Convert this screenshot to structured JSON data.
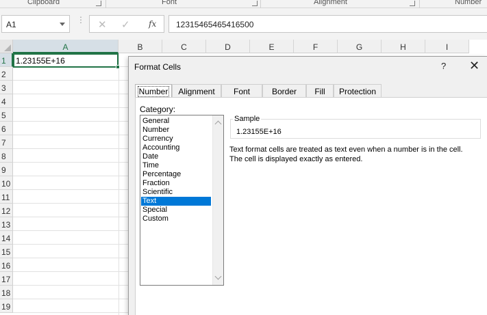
{
  "ribbon": {
    "groups": [
      "Clipboard",
      "Font",
      "Alignment",
      "Number"
    ]
  },
  "formula_bar": {
    "name_box": "A1",
    "cancel_icon": "x-icon",
    "enter_icon": "check-icon",
    "fx_label": "fx",
    "value": "12315465465416500"
  },
  "grid": {
    "columns": [
      "A",
      "B",
      "C",
      "D",
      "E",
      "F",
      "G",
      "H",
      "I"
    ],
    "rows": [
      "1",
      "2",
      "3",
      "4",
      "5",
      "6",
      "7",
      "8",
      "9",
      "10",
      "11",
      "12",
      "13",
      "14",
      "15",
      "16",
      "17",
      "18",
      "19"
    ],
    "selected_column": "A",
    "selected_row": "1",
    "cell_a1": "1.23155E+16",
    "accent_color": "#217346"
  },
  "dialog": {
    "title": "Format Cells",
    "help": "?",
    "close": "✕",
    "tabs": [
      "Number",
      "Alignment",
      "Font",
      "Border",
      "Fill",
      "Protection"
    ],
    "active_tab": "Number",
    "category_label": "Category:",
    "categories": [
      "General",
      "Number",
      "Currency",
      "Accounting",
      "Date",
      "Time",
      "Percentage",
      "Fraction",
      "Scientific",
      "Text",
      "Special",
      "Custom"
    ],
    "selected_category": "Text",
    "sample_label": "Sample",
    "sample_value": "1.23155E+16",
    "description_line1": "Text format cells are treated as text even when a number is in the cell.",
    "description_line2": "The cell is displayed exactly as entered.",
    "selection_color": "#0078d7"
  }
}
